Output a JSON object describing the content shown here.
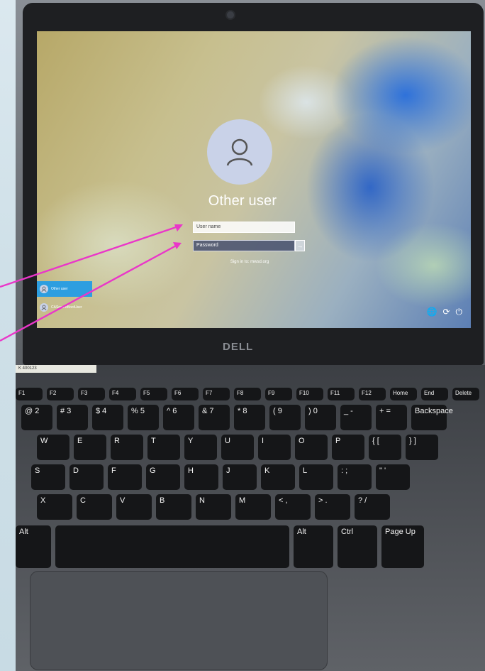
{
  "login": {
    "username_display": "Other user",
    "username_placeholder": "User name",
    "password_placeholder": "Password",
    "sign_in_hint": "Sign in to: mwsd.org",
    "submit_arrow": "→"
  },
  "user_list": [
    {
      "label": "Other user"
    },
    {
      "label": "CASecureBootUser"
    }
  ],
  "tray": {
    "globe": "🌐",
    "ease": "⟳",
    "power": "⏻"
  },
  "laptop": {
    "brand": "DELL",
    "asset_tag": "K 400123"
  },
  "keyboard": {
    "fn_row": [
      "F1",
      "F2",
      "F3",
      "F4",
      "F5",
      "F6",
      "F7",
      "F8",
      "F9",
      "F10",
      "F11",
      "F12",
      "Home",
      "End",
      "Delete"
    ],
    "row1": [
      "@ 2",
      "# 3",
      "$ 4",
      "% 5",
      "^ 6",
      "& 7",
      "* 8",
      "( 9",
      ") 0",
      "_ -",
      "+ =",
      "Backspace"
    ],
    "row2": [
      "W",
      "E",
      "R",
      "T",
      "Y",
      "U",
      "I",
      "O",
      "P",
      "{ [",
      "} ]"
    ],
    "row3": [
      "S",
      "D",
      "F",
      "G",
      "H",
      "J",
      "K",
      "L",
      ": ;",
      "\" '"
    ],
    "row4": [
      "X",
      "C",
      "V",
      "B",
      "N",
      "M",
      "< ,",
      "> .",
      "? /"
    ],
    "row5": [
      "Alt",
      "",
      "Alt",
      "Ctrl",
      "Page Up"
    ]
  },
  "annotation": {
    "arrow_color": "#ea36c9"
  }
}
